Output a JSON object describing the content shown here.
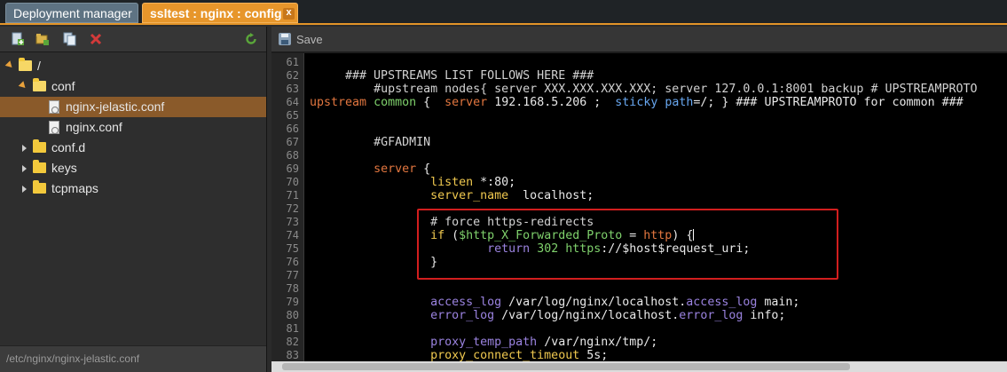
{
  "tabs": [
    {
      "label": "Deployment manager"
    },
    {
      "label": "ssltest : nginx : config",
      "close": "x"
    }
  ],
  "colors": {
    "accent": "#e7962b",
    "selection": "#8a5a2a",
    "highlight_box": "#d21e1e"
  },
  "left_toolbar": {
    "icons": [
      "new-file-icon",
      "new-folder-icon",
      "copy-icon",
      "delete-icon",
      "refresh-icon"
    ]
  },
  "tree": [
    {
      "label": "/",
      "icon": "folder-open-icon"
    },
    {
      "label": "conf",
      "icon": "folder-open-icon"
    },
    {
      "label": "nginx-jelastic.conf",
      "icon": "file-config-icon",
      "selected": true
    },
    {
      "label": "nginx.conf",
      "icon": "file-config-icon"
    },
    {
      "label": "conf.d",
      "icon": "folder-icon"
    },
    {
      "label": "keys",
      "icon": "folder-icon"
    },
    {
      "label": "tcpmaps",
      "icon": "folder-icon"
    }
  ],
  "status_path": "/etc/nginx/nginx-jelastic.conf",
  "editor_toolbar": {
    "save_label": "Save"
  },
  "editor": {
    "lines": [
      {
        "n": "61",
        "text": ""
      },
      {
        "n": "62",
        "text": "     ### UPSTREAMS LIST FOLLOWS HERE ###"
      },
      {
        "n": "63",
        "text": "         #upstream nodes{ server XXX.XXX.XXX.XXX; server 127.0.0.1:8001 backup # UPSTREAMPROTO"
      },
      {
        "n": "64",
        "text": "upstream common {  server 192.168.5.206 ;  sticky path=/; } ### UPSTREAMPROTO for common ###"
      },
      {
        "n": "65",
        "text": ""
      },
      {
        "n": "66",
        "text": ""
      },
      {
        "n": "67",
        "text": "         #GFADMIN"
      },
      {
        "n": "68",
        "text": ""
      },
      {
        "n": "69",
        "text": "         server {"
      },
      {
        "n": "70",
        "text": "                 listen *:80;"
      },
      {
        "n": "71",
        "text": "                 server_name  localhost;"
      },
      {
        "n": "72",
        "text": ""
      },
      {
        "n": "73",
        "text": "                 # force https-redirects"
      },
      {
        "n": "74",
        "text": "                 if ($http_X_Forwarded_Proto = http) {"
      },
      {
        "n": "75",
        "text": "                         return 302 https://$host$request_uri;"
      },
      {
        "n": "76",
        "text": "                 }"
      },
      {
        "n": "77",
        "text": ""
      },
      {
        "n": "78",
        "text": ""
      },
      {
        "n": "79",
        "text": "                 access_log /var/log/nginx/localhost.access_log main;"
      },
      {
        "n": "80",
        "text": "                 error_log /var/log/nginx/localhost.error_log info;"
      },
      {
        "n": "81",
        "text": ""
      },
      {
        "n": "82",
        "text": "                 proxy_temp_path /var/nginx/tmp/;"
      },
      {
        "n": "83",
        "text": "                 proxy_connect_timeout 5s;"
      }
    ]
  }
}
